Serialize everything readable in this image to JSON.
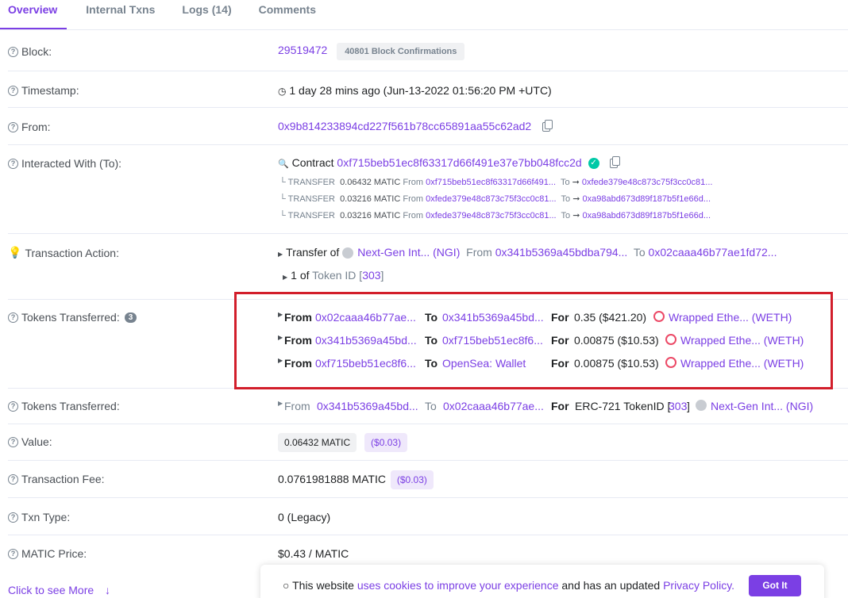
{
  "tabs": [
    "Overview",
    "Internal Txns",
    "Logs (14)",
    "Comments"
  ],
  "block": {
    "label": "Block:",
    "number": "29519472",
    "confirmations": "40801 Block Confirmations"
  },
  "timestamp": {
    "label": "Timestamp:",
    "value": "1 day 28 mins ago (Jun-13-2022 01:56:20 PM +UTC)"
  },
  "from": {
    "label": "From:",
    "address": "0x9b814233894cd227f561b78cc65891aa55c62ad2"
  },
  "interacted": {
    "label": "Interacted With (To):",
    "prefix": "Contract",
    "address": "0xf715beb51ec8f63317d66f491e37e7bb048fcc2d",
    "transfers": [
      {
        "type": "TRANSFER",
        "amount": "0.06432 MATIC",
        "from_label": "From",
        "from": "0xf715beb51ec8f63317d66f491...",
        "to_label": "To",
        "to": "0xfede379e48c873c75f3cc0c81..."
      },
      {
        "type": "TRANSFER",
        "amount": "0.03216 MATIC",
        "from_label": "From",
        "from": "0xfede379e48c873c75f3cc0c81...",
        "to_label": "To",
        "to": "0xa98abd673d89f187b5f1e66d..."
      },
      {
        "type": "TRANSFER",
        "amount": "0.03216 MATIC",
        "from_label": "From",
        "from": "0xfede379e48c873c75f3cc0c81...",
        "to_label": "To",
        "to": "0xa98abd673d89f187b5f1e66d..."
      }
    ]
  },
  "action": {
    "label": "Transaction Action:",
    "prefix": "Transfer of",
    "token": "Next-Gen Int... (NGI)",
    "from_label": "From",
    "from": "0x341b5369a45bdba794...",
    "to_label": "To",
    "to": "0x02caaa46b77ae1fd72...",
    "sub_count": "1 of",
    "sub_text": "Token ID [",
    "token_id": "303",
    "sub_end": "]"
  },
  "tokens_transferred": {
    "label": "Tokens Transferred:",
    "count": "3",
    "rows": [
      {
        "from_label": "From",
        "from": "0x02caaa46b77ae...",
        "to_label": "To",
        "to": "0x341b5369a45bd...",
        "for_label": "For",
        "amount": "0.35 ($421.20)",
        "token": "Wrapped Ethe... (WETH)"
      },
      {
        "from_label": "From",
        "from": "0x341b5369a45bd...",
        "to_label": "To",
        "to": "0xf715beb51ec8f6...",
        "for_label": "For",
        "amount": "0.00875 ($10.53)",
        "token": "Wrapped Ethe... (WETH)"
      },
      {
        "from_label": "From",
        "from": "0xf715beb51ec8f6...",
        "to_label": "To",
        "to": "OpenSea: Wallet",
        "for_label": "For",
        "amount": "0.00875 ($10.53)",
        "token": "Wrapped Ethe... (WETH)"
      }
    ]
  },
  "tokens_transferred_2": {
    "label": "Tokens Transferred:",
    "from_label": "From",
    "from": "0x341b5369a45bd...",
    "to_label": "To",
    "to": "0x02caaa46b77ae...",
    "for_label": "For",
    "standard": "ERC-721 TokenID [",
    "token_id": "303",
    "close": "]",
    "token": "Next-Gen Int... (NGI)"
  },
  "value": {
    "label": "Value:",
    "amount": "0.06432 MATIC",
    "usd": "($0.03)"
  },
  "fee": {
    "label": "Transaction Fee:",
    "amount": "0.0761981888 MATIC",
    "usd": "($0.03)"
  },
  "txn_type": {
    "label": "Txn Type:",
    "value": "0 (Legacy)"
  },
  "price": {
    "label": "MATIC Price:",
    "value": "$0.43 / MATIC"
  },
  "more": {
    "label": "Click to see More"
  },
  "cookie": {
    "text1": "This website",
    "link1": "uses cookies to improve your experience",
    "text2": "and has an updated",
    "link2": "Privacy Policy.",
    "button": "Got It"
  },
  "colors": {
    "accent": "#7b3fe4",
    "highlight_box": "#d21e2b",
    "verified": "#00c9a7"
  }
}
